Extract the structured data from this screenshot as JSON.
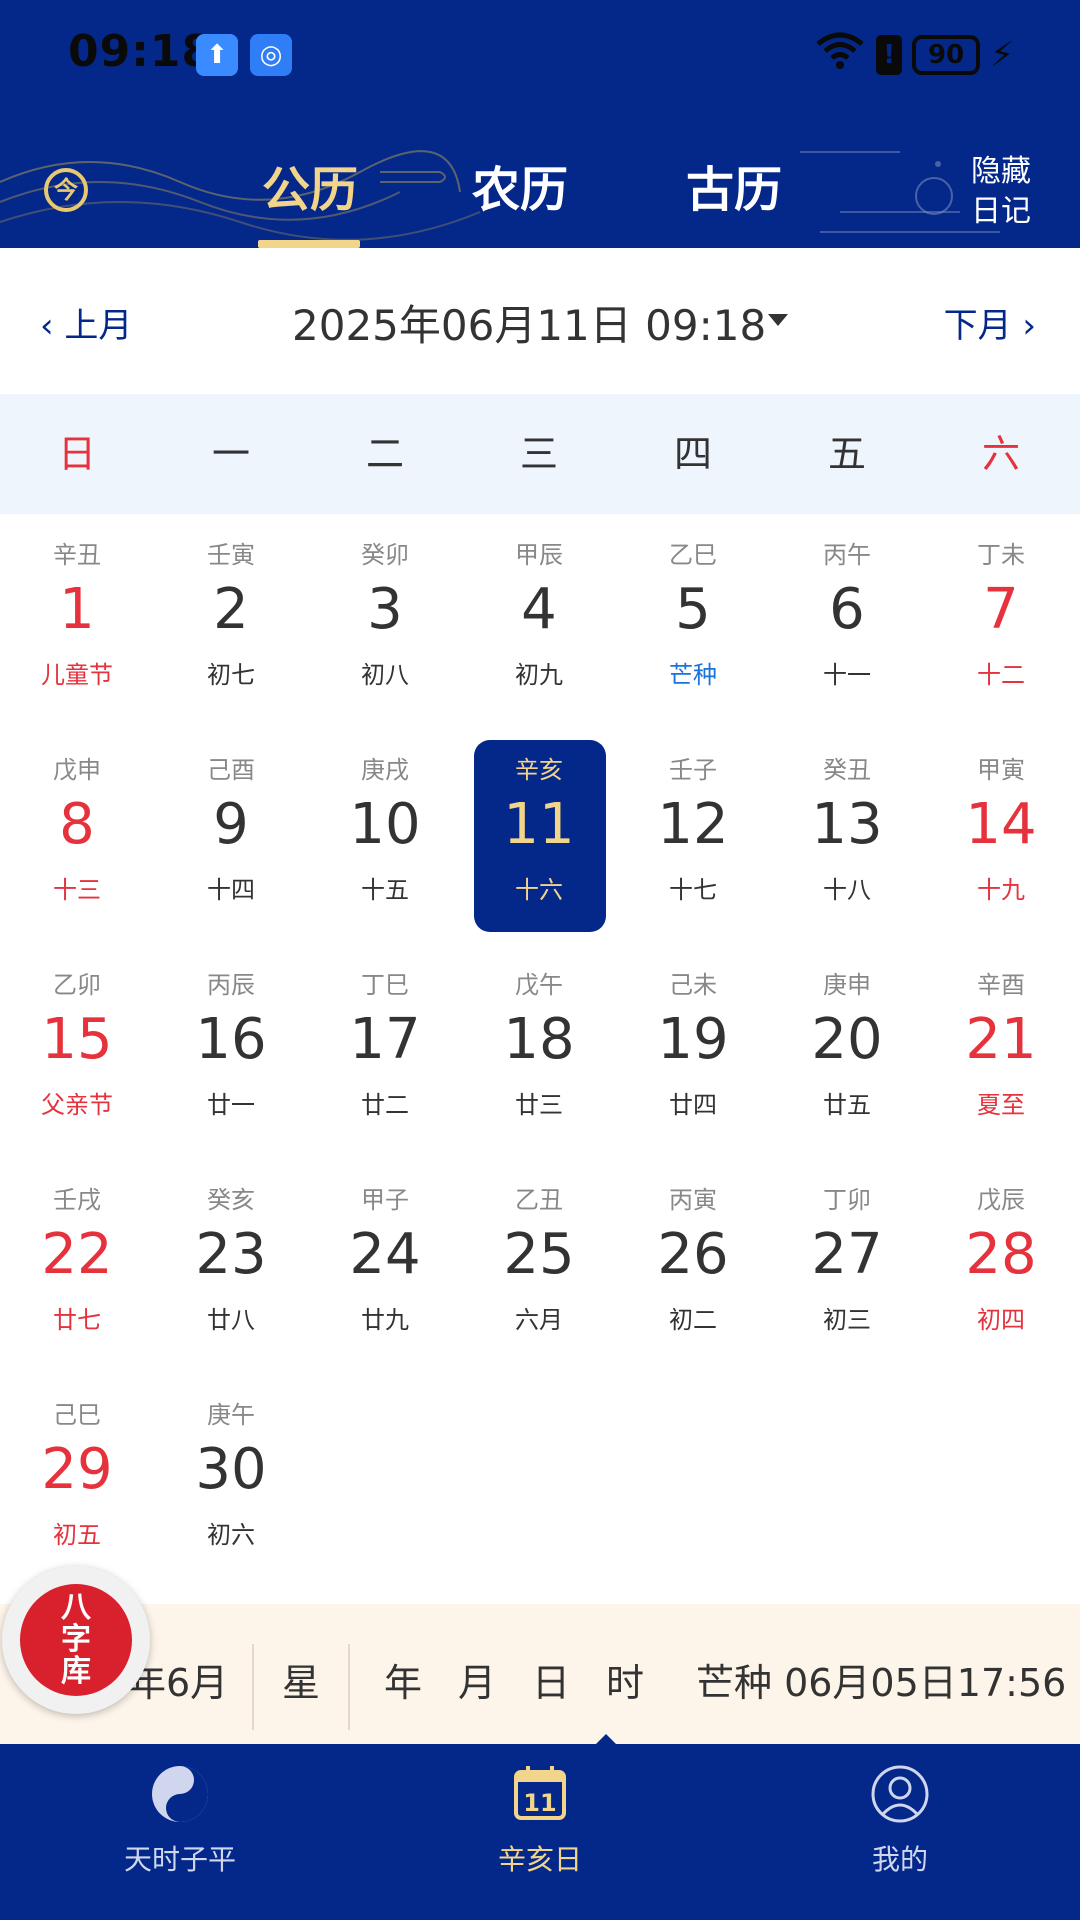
{
  "status_bar": {
    "time": "09:18",
    "battery": "90",
    "alert": "!"
  },
  "header": {
    "today_icon": "今",
    "tabs": [
      {
        "label": "公历",
        "active": true
      },
      {
        "label": "农历",
        "active": false
      },
      {
        "label": "古历",
        "active": false
      }
    ],
    "hide_diary_line1": "隐藏",
    "hide_diary_line2": "日记"
  },
  "month_nav": {
    "prev": "‹ 上月",
    "next": "下月 ›",
    "current": "2025年06月11日 09:18"
  },
  "weekdays": [
    "日",
    "一",
    "二",
    "三",
    "四",
    "五",
    "六"
  ],
  "days": [
    {
      "gz": "辛丑",
      "num": "1",
      "lunar": "儿童节",
      "style": "red"
    },
    {
      "gz": "壬寅",
      "num": "2",
      "lunar": "初七"
    },
    {
      "gz": "癸卯",
      "num": "3",
      "lunar": "初八"
    },
    {
      "gz": "甲辰",
      "num": "4",
      "lunar": "初九"
    },
    {
      "gz": "乙巳",
      "num": "5",
      "lunar": "芒种",
      "style": "blue"
    },
    {
      "gz": "丙午",
      "num": "6",
      "lunar": "十一"
    },
    {
      "gz": "丁未",
      "num": "7",
      "lunar": "十二"
    },
    {
      "gz": "戊申",
      "num": "8",
      "lunar": "十三"
    },
    {
      "gz": "己酉",
      "num": "9",
      "lunar": "十四"
    },
    {
      "gz": "庚戌",
      "num": "10",
      "lunar": "十五"
    },
    {
      "gz": "辛亥",
      "num": "11",
      "lunar": "十六",
      "selected": true
    },
    {
      "gz": "壬子",
      "num": "12",
      "lunar": "十七"
    },
    {
      "gz": "癸丑",
      "num": "13",
      "lunar": "十八"
    },
    {
      "gz": "甲寅",
      "num": "14",
      "lunar": "十九"
    },
    {
      "gz": "乙卯",
      "num": "15",
      "lunar": "父亲节",
      "style": "red"
    },
    {
      "gz": "丙辰",
      "num": "16",
      "lunar": "廿一"
    },
    {
      "gz": "丁巳",
      "num": "17",
      "lunar": "廿二"
    },
    {
      "gz": "戊午",
      "num": "18",
      "lunar": "廿三"
    },
    {
      "gz": "己未",
      "num": "19",
      "lunar": "廿四"
    },
    {
      "gz": "庚申",
      "num": "20",
      "lunar": "廿五"
    },
    {
      "gz": "辛酉",
      "num": "21",
      "lunar": "夏至",
      "style": "red"
    },
    {
      "gz": "壬戌",
      "num": "22",
      "lunar": "廿七"
    },
    {
      "gz": "癸亥",
      "num": "23",
      "lunar": "廿八"
    },
    {
      "gz": "甲子",
      "num": "24",
      "lunar": "廿九"
    },
    {
      "gz": "乙丑",
      "num": "25",
      "lunar": "六月"
    },
    {
      "gz": "丙寅",
      "num": "26",
      "lunar": "初二"
    },
    {
      "gz": "丁卯",
      "num": "27",
      "lunar": "初三"
    },
    {
      "gz": "戊辰",
      "num": "28",
      "lunar": "初四"
    },
    {
      "gz": "己巳",
      "num": "29",
      "lunar": "初五"
    },
    {
      "gz": "庚午",
      "num": "30",
      "lunar": "初六"
    }
  ],
  "info_strip": {
    "month": "年6月",
    "week": "星",
    "pillars": [
      "年",
      "月",
      "日",
      "时"
    ],
    "solar_term": "芒种 06月05日17:56"
  },
  "bazi_badge": {
    "line1": "八",
    "line2": "字",
    "line3": "库"
  },
  "bottom_nav": [
    {
      "label": "天时子平",
      "icon": "yin-yang-icon",
      "active": false
    },
    {
      "label": "辛亥日",
      "icon": "calendar-day-icon",
      "icon_text": "11",
      "active": true
    },
    {
      "label": "我的",
      "icon": "user-icon",
      "active": false
    }
  ],
  "colors": {
    "brand_blue": "#04288a",
    "gold": "#f2d48a",
    "red": "#e5323c",
    "term_blue": "#1a73d9"
  }
}
